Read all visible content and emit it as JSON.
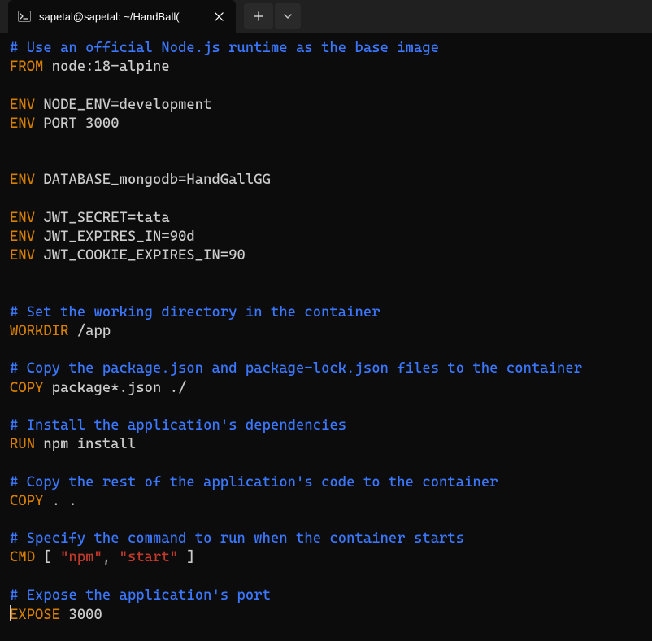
{
  "titlebar": {
    "tab_title": "sapetal@sapetal: ~/HandBall(",
    "close_glyph": "✕",
    "plus_glyph": "+",
    "chevron_glyph": "⌄"
  },
  "code": {
    "lines": [
      {
        "parts": [
          {
            "cls": "c-comment",
            "t": "# Use an official Node.js runtime as the base image"
          }
        ]
      },
      {
        "parts": [
          {
            "cls": "c-keyword",
            "t": "FROM"
          },
          {
            "cls": "c-text",
            "t": " node:18-alpine"
          }
        ]
      },
      {
        "parts": []
      },
      {
        "parts": [
          {
            "cls": "c-keyword",
            "t": "ENV"
          },
          {
            "cls": "c-text",
            "t": " NODE_ENV=development"
          }
        ]
      },
      {
        "parts": [
          {
            "cls": "c-keyword",
            "t": "ENV"
          },
          {
            "cls": "c-text",
            "t": " PORT 3000"
          }
        ]
      },
      {
        "parts": []
      },
      {
        "parts": []
      },
      {
        "parts": [
          {
            "cls": "c-keyword",
            "t": "ENV"
          },
          {
            "cls": "c-text",
            "t": " DATABASE_mongodb=HandGallGG"
          }
        ]
      },
      {
        "parts": []
      },
      {
        "parts": [
          {
            "cls": "c-keyword",
            "t": "ENV"
          },
          {
            "cls": "c-text",
            "t": " JWT_SECRET=tata"
          }
        ]
      },
      {
        "parts": [
          {
            "cls": "c-keyword",
            "t": "ENV"
          },
          {
            "cls": "c-text",
            "t": " JWT_EXPIRES_IN=90d"
          }
        ]
      },
      {
        "parts": [
          {
            "cls": "c-keyword",
            "t": "ENV"
          },
          {
            "cls": "c-text",
            "t": " JWT_COOKIE_EXPIRES_IN=90"
          }
        ]
      },
      {
        "parts": []
      },
      {
        "parts": []
      },
      {
        "parts": [
          {
            "cls": "c-comment",
            "t": "# Set the working directory in the container"
          }
        ]
      },
      {
        "parts": [
          {
            "cls": "c-keyword",
            "t": "WORKDIR"
          },
          {
            "cls": "c-text",
            "t": " /app"
          }
        ]
      },
      {
        "parts": []
      },
      {
        "parts": [
          {
            "cls": "c-comment",
            "t": "# Copy the package.json and package-lock.json files to the container"
          }
        ]
      },
      {
        "parts": [
          {
            "cls": "c-keyword",
            "t": "COPY"
          },
          {
            "cls": "c-text",
            "t": " package*.json ./"
          }
        ]
      },
      {
        "parts": []
      },
      {
        "parts": [
          {
            "cls": "c-comment",
            "t": "# Install the application's dependencies"
          }
        ]
      },
      {
        "parts": [
          {
            "cls": "c-keyword",
            "t": "RUN"
          },
          {
            "cls": "c-text",
            "t": " npm install"
          }
        ]
      },
      {
        "parts": []
      },
      {
        "parts": [
          {
            "cls": "c-comment",
            "t": "# Copy the rest of the application's code to the container"
          }
        ]
      },
      {
        "parts": [
          {
            "cls": "c-keyword",
            "t": "COPY"
          },
          {
            "cls": "c-text",
            "t": " . ."
          }
        ]
      },
      {
        "parts": []
      },
      {
        "parts": [
          {
            "cls": "c-comment",
            "t": "# Specify the command to run when the container starts"
          }
        ]
      },
      {
        "parts": [
          {
            "cls": "c-keyword",
            "t": "CMD"
          },
          {
            "cls": "c-text",
            "t": " [ "
          },
          {
            "cls": "c-str",
            "t": "\"npm\""
          },
          {
            "cls": "c-text",
            "t": ", "
          },
          {
            "cls": "c-str",
            "t": "\"start\""
          },
          {
            "cls": "c-text",
            "t": " ]"
          }
        ]
      },
      {
        "parts": []
      },
      {
        "parts": [
          {
            "cls": "c-comment",
            "t": "# Expose the application's port"
          }
        ]
      },
      {
        "cursor": true,
        "parts": [
          {
            "cls": "c-keyword",
            "t": "EXPOSE"
          },
          {
            "cls": "c-text",
            "t": " 3000"
          }
        ]
      }
    ]
  }
}
